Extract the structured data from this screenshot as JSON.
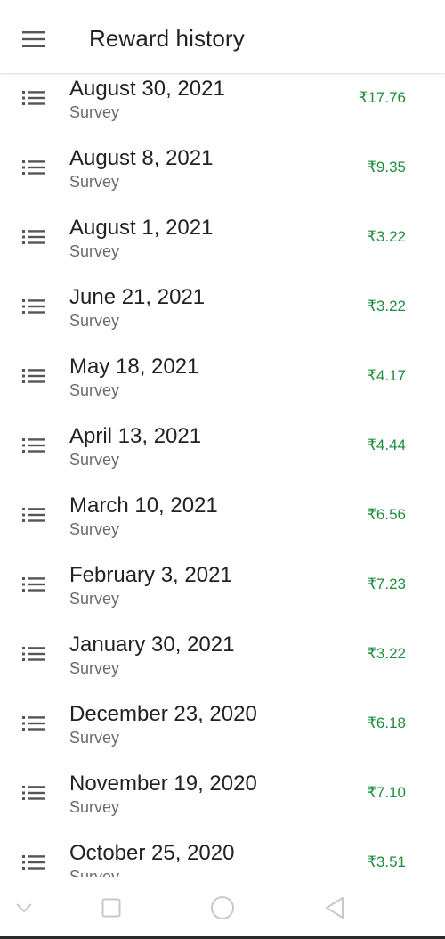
{
  "header": {
    "title": "Reward history",
    "menu_icon": "hamburger-menu-icon"
  },
  "rewards": [
    {
      "date": "August 30, 2021",
      "type": "Survey",
      "amount": "₹17.76",
      "icon": "list-icon"
    },
    {
      "date": "August 8, 2021",
      "type": "Survey",
      "amount": "₹9.35",
      "icon": "list-icon"
    },
    {
      "date": "August 1, 2021",
      "type": "Survey",
      "amount": "₹3.22",
      "icon": "list-icon"
    },
    {
      "date": "June 21, 2021",
      "type": "Survey",
      "amount": "₹3.22",
      "icon": "list-icon"
    },
    {
      "date": "May 18, 2021",
      "type": "Survey",
      "amount": "₹4.17",
      "icon": "list-icon"
    },
    {
      "date": "April 13, 2021",
      "type": "Survey",
      "amount": "₹4.44",
      "icon": "list-icon"
    },
    {
      "date": "March 10, 2021",
      "type": "Survey",
      "amount": "₹6.56",
      "icon": "list-icon"
    },
    {
      "date": "February 3, 2021",
      "type": "Survey",
      "amount": "₹7.23",
      "icon": "list-icon"
    },
    {
      "date": "January 30, 2021",
      "type": "Survey",
      "amount": "₹3.22",
      "icon": "list-icon"
    },
    {
      "date": "December 23, 2020",
      "type": "Survey",
      "amount": "₹6.18",
      "icon": "list-icon"
    },
    {
      "date": "November 19, 2020",
      "type": "Survey",
      "amount": "₹7.10",
      "icon": "list-icon"
    },
    {
      "date": "October 25, 2020",
      "type": "Survey",
      "amount": "₹3.51",
      "icon": "list-icon"
    }
  ],
  "colors": {
    "amount": "#1e8e3e",
    "primary_text": "#222222",
    "secondary_text": "#6b6b6b",
    "nav_icon": "#c8c8c8"
  },
  "system_nav": {
    "buttons": [
      "collapse-chevron-icon",
      "recents-square-icon",
      "home-circle-icon",
      "back-triangle-icon"
    ]
  }
}
